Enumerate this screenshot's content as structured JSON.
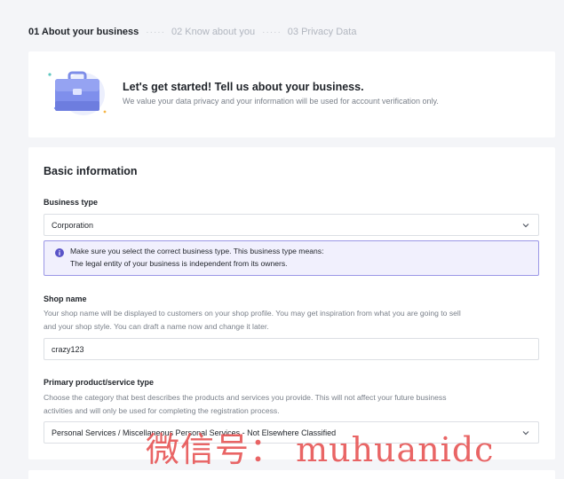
{
  "steps": [
    {
      "label": "01 About your business"
    },
    {
      "label": "02 Know about you"
    },
    {
      "label": "03 Privacy Data"
    }
  ],
  "intro": {
    "title": "Let's get started! Tell us about your business.",
    "subtitle": "We value your data privacy and your information will be used for account verification only."
  },
  "form": {
    "section_title": "Basic information",
    "business_type": {
      "label": "Business type",
      "value": "Corporation"
    },
    "info_box": {
      "line1": "Make sure you select the correct business type. This business type means:",
      "line2": "The legal entity of your business is independent from its owners."
    },
    "shop_name": {
      "label": "Shop name",
      "help_line1": "Your shop name will be displayed to customers on your shop profile. You may get inspiration from what you are going to sell",
      "help_line2": "and your shop style. You can draft a name now and change it later.",
      "value": "crazy123"
    },
    "category": {
      "label": "Primary product/service type",
      "help_line1": "Choose the category that best describes the products and services you provide. This will not affect your future business",
      "help_line2": "activities and will only be used for completing the registration process.",
      "value": "Personal Services / Miscellaneous Personal Services - Not Elsewhere Classified"
    }
  },
  "watermark": "微信号： muhuanidc",
  "colors": {
    "accent": "#6c63d8",
    "info_border": "#9b97e6",
    "info_bg": "#f1f0fd"
  }
}
